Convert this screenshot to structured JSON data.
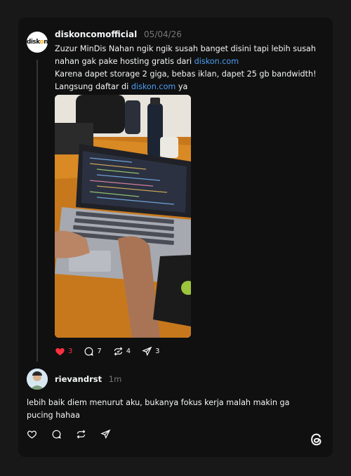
{
  "post": {
    "username": "diskoncomofficial",
    "date": "05/04/26",
    "avatar_logo": "diskon",
    "line1_before": "Zuzur MinDis Nahan ngik ngik susah banget disini tapi lebih susah nahan gak pake hosting gratis dari ",
    "line1_link": "diskon.com",
    "line2": "Karena dapet storage 2 giga, bebas iklan, dapet 25 gb bandwidth!",
    "line3_before": "Langsung daftar di ",
    "line3_link": "diskon.com",
    "line3_after": " ya",
    "likes": "3",
    "comments": "7",
    "reposts": "4",
    "shares": "3"
  },
  "reply": {
    "username": "rievandrst",
    "time": "1m",
    "text": "lebih baik diem menurut aku, bukanya fokus kerja malah makin ga pucing hahaa"
  },
  "colors": {
    "background": "#181818",
    "card": "#101010",
    "link": "#4a9ff5",
    "like": "#ff3040",
    "muted": "#777777"
  },
  "icons": [
    "heart-icon",
    "comment-icon",
    "repost-icon",
    "share-icon",
    "threads-logo-icon"
  ]
}
